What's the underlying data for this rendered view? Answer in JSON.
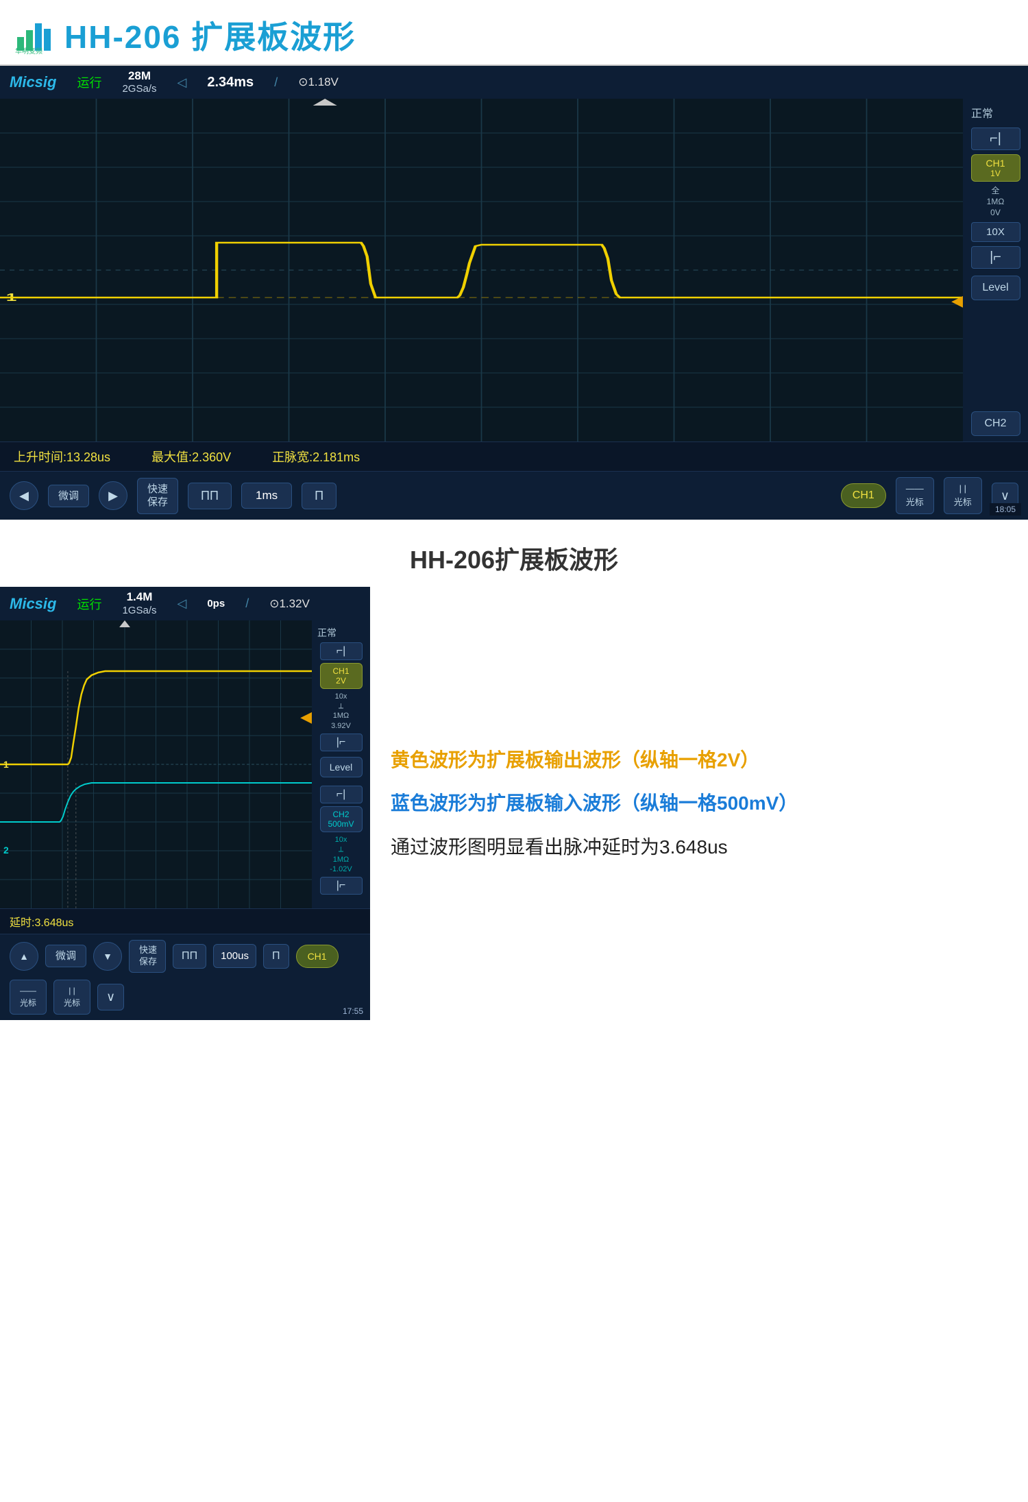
{
  "header": {
    "company": "华明变频",
    "title": "HH-206 扩展板波形"
  },
  "scope1": {
    "brand": "Micsig",
    "status": "运行",
    "memory": "28M",
    "sample_rate": "2GSa/s",
    "time_div": "2.34ms",
    "trigger_icon": "⊙",
    "trigger_val": "1.18V",
    "normal": "正常",
    "ch1_label": "CH1",
    "ch1_volt": "1V",
    "ch1_coupling": "全",
    "ch1_impedance": "1MΩ",
    "ch1_offset": "0V",
    "level_label": "Level",
    "ch2_label": "CH2",
    "rise_time": "上升时间:13.28us",
    "max_val": "最大值:2.360V",
    "pulse_width": "正脉宽:2.181ms",
    "time_display": "18:05",
    "controls": {
      "left_arrow": "◀",
      "fine_adj": "微调",
      "right_arrow": "▶",
      "quick_save": "快速\n保存",
      "wave_double": "ΠΠ",
      "time_1ms": "1ms",
      "wave_single": "Π",
      "ch1_btn": "CH1",
      "cursor1": "光标",
      "cursor2": "光标",
      "expand": "∨"
    }
  },
  "section2_title": "HH-206扩展板波形",
  "scope2": {
    "brand": "Micsig",
    "status": "运行",
    "memory": "1.4M",
    "sample_rate": "1GSa/s",
    "time_ref": "0ps",
    "trigger_icon": "⊙",
    "trigger_val": "1.32V",
    "normal": "正常",
    "ch1_label": "CH1",
    "ch1_volt": "2V",
    "ch1_10x": "10x",
    "ch1_impedance": "1MΩ",
    "ch1_offset": "3.92V",
    "ch2_label": "CH2",
    "ch2_volt": "500mV",
    "ch2_10x": "10x",
    "ch2_impedance": "1MΩ",
    "ch2_offset": "-1.02V",
    "level_label": "Level",
    "delay_time": "延时:3.648us",
    "time_display": "17:55",
    "controls": {
      "up_arrow": "▲",
      "fine_adj": "微调",
      "down_arrow": "▼",
      "quick_save": "快速\n保存",
      "wave_double": "ΠΠ",
      "time_100us": "100us",
      "wave_single": "Π",
      "ch1_btn": "CH1",
      "cursor1": "光标",
      "cursor2": "光标",
      "expand": "∨"
    }
  },
  "annotations": {
    "yellow_text": "黄色波形为扩展板输出波形（纵轴一格2V）",
    "blue_text": "蓝色波形为扩展板输入波形（纵轴一格500mV）",
    "delay_text": "通过波形图明显看出脉冲延时为3.648us"
  }
}
